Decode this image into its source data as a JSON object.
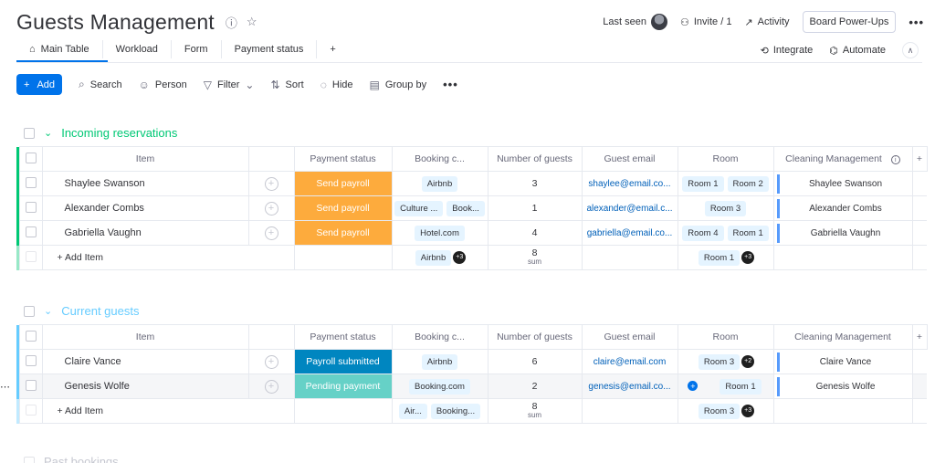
{
  "board": {
    "title": "Guests Management",
    "last_seen_label": "Last seen",
    "invite_label": "Invite / 1",
    "activity_label": "Activity",
    "power_ups_label": "Board Power-Ups"
  },
  "tabs": [
    {
      "label": "Main Table"
    },
    {
      "label": "Workload"
    },
    {
      "label": "Form"
    },
    {
      "label": "Payment status"
    },
    {
      "label": "+"
    }
  ],
  "integrations": {
    "integrate_label": "Integrate",
    "automate_label": "Automate"
  },
  "toolbar": {
    "add_label": "Add",
    "search_label": "Search",
    "person_label": "Person",
    "filter_label": "Filter",
    "sort_label": "Sort",
    "hide_label": "Hide",
    "group_by_label": "Group by"
  },
  "columns": {
    "item": "Item",
    "payment": "Payment status",
    "booking": "Booking c...",
    "guests": "Number of guests",
    "email": "Guest email",
    "room": "Room",
    "cleaning": "Cleaning Management"
  },
  "colors": {
    "incoming": "#00c875",
    "current": "#66ccff",
    "send_payroll": "#fdab3d",
    "payroll_submitted": "#0086c0",
    "pending_payment": "#66d1c7"
  },
  "groups": {
    "incoming": {
      "title": "Incoming reservations",
      "rows": [
        {
          "name": "Shaylee Swanson",
          "status": "Send payroll",
          "booking": [
            "Airbnb"
          ],
          "guests": "3",
          "email": "shaylee@email.co...",
          "rooms": [
            "Room 1",
            "Room 2"
          ],
          "cleaning": "Shaylee Swanson"
        },
        {
          "name": "Alexander Combs",
          "status": "Send payroll",
          "booking": [
            "Culture ...",
            "Book..."
          ],
          "guests": "1",
          "email": "alexander@email.c...",
          "rooms": [
            "Room 3"
          ],
          "cleaning": "Alexander Combs"
        },
        {
          "name": "Gabriella Vaughn",
          "status": "Send payroll",
          "booking": [
            "Hotel.com"
          ],
          "guests": "4",
          "email": "gabriella@email.co...",
          "rooms": [
            "Room 4",
            "Room 1"
          ],
          "cleaning": "Gabriella Vaughn"
        }
      ],
      "footer": {
        "add_item": "+ Add Item",
        "booking_chip": "Airbnb",
        "booking_more": "+3",
        "sum": "8",
        "sum_label": "sum",
        "room_chip": "Room 1",
        "room_more": "+3"
      }
    },
    "current": {
      "title": "Current guests",
      "rows": [
        {
          "name": "Claire Vance",
          "status": "Payroll submitted",
          "booking": [
            "Airbnb"
          ],
          "guests": "6",
          "email": "claire@email.com",
          "rooms": [
            "Room 3"
          ],
          "room_more": "+2",
          "cleaning": "Claire Vance"
        },
        {
          "name": "Genesis Wolfe",
          "status": "Pending payment",
          "booking": [
            "Booking.com"
          ],
          "guests": "2",
          "email": "genesis@email.co...",
          "rooms": [
            "Room 1"
          ],
          "cleaning": "Genesis Wolfe"
        }
      ],
      "footer": {
        "add_item": "+ Add Item",
        "booking_chips": [
          "Air...",
          "Booking..."
        ],
        "sum": "8",
        "sum_label": "sum",
        "room_chip": "Room 3",
        "room_more": "+3"
      }
    },
    "past": {
      "title": "Past bookings"
    }
  }
}
